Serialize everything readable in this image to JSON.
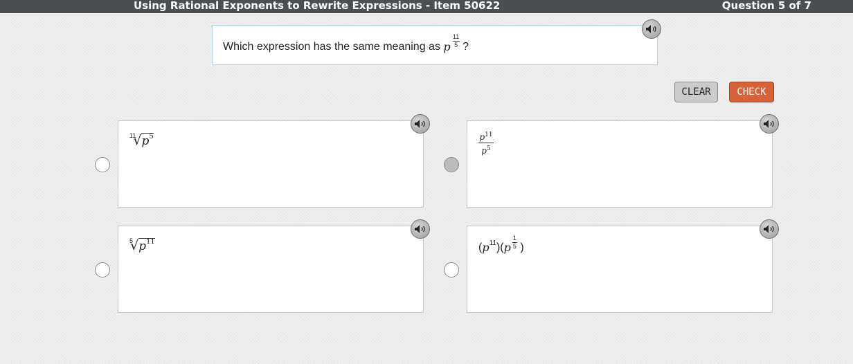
{
  "header": {
    "title": "Using Rational Exponents to Rewrite Expressions - Item 50622",
    "counter": "Question 5 of 7"
  },
  "question": {
    "text": "Which expression has the same meaning as",
    "base": "p",
    "exp_num": "11",
    "exp_den": "5",
    "end": "?",
    "audio_icon": "speaker-icon"
  },
  "buttons": {
    "clear": "CLEAR",
    "check": "CHECK"
  },
  "choices": [
    {
      "id": "a",
      "root_index": "11",
      "base": "p",
      "exponent": "5",
      "selected": false,
      "audio_icon": "speaker-icon"
    },
    {
      "id": "b",
      "num_base": "p",
      "num_exp": "11",
      "den_base": "p",
      "den_exp": "5",
      "selected": true,
      "audio_icon": "speaker-icon"
    },
    {
      "id": "c",
      "root_index": "5",
      "base": "p",
      "exponent": "11",
      "selected": false,
      "audio_icon": "speaker-icon"
    },
    {
      "id": "d",
      "open1": "(",
      "base1": "p",
      "exp1": "11",
      "close1": ")",
      "open2": "(",
      "base2": "p",
      "exp2_num": "1",
      "exp2_den": "5",
      "close2": ")",
      "selected": false,
      "audio_icon": "speaker-icon"
    }
  ],
  "colors": {
    "header_bg": "#4b4f52",
    "check_button": "#d7623a",
    "clear_button": "#c9cbcc",
    "question_border": "#a9d3e2"
  }
}
